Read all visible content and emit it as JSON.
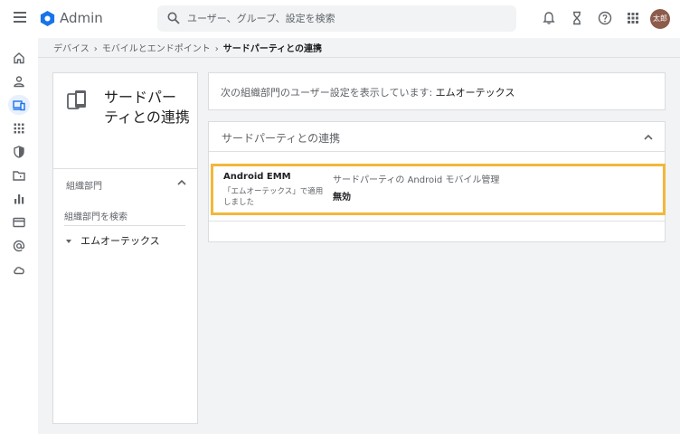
{
  "header": {
    "app_title": "Admin",
    "search_placeholder": "ユーザー、グループ、設定を検索",
    "avatar_text": "太郎",
    "brand_color": "#1a73e8",
    "avatar_color": "#8d5b4c"
  },
  "nav": {
    "items": [
      {
        "icon": "home-icon"
      },
      {
        "icon": "person-icon"
      },
      {
        "icon": "devices-icon",
        "active": true
      },
      {
        "icon": "apps-icon"
      },
      {
        "icon": "security-icon"
      },
      {
        "icon": "folder-icon"
      },
      {
        "icon": "reports-icon"
      },
      {
        "icon": "billing-icon"
      },
      {
        "icon": "account-icon"
      },
      {
        "icon": "cloud-icon"
      }
    ]
  },
  "breadcrumb": {
    "items": [
      "デバイス",
      "モバイルとエンドポイント"
    ],
    "current": "サードパーティとの連携"
  },
  "left_panel": {
    "title": "サードパーティとの連携",
    "ou_label": "組織部門",
    "ou_search_placeholder": "組織部門を検索",
    "tree_item": "エムオーテックス"
  },
  "info": {
    "label": "次の組織部門のユーザー設定を表示しています: ",
    "value": "エムオーテックス"
  },
  "settings": {
    "section_title": "サードパーティとの連携",
    "row": {
      "name": "Android EMM",
      "applied": "「エムオーテックス」で適用しました",
      "setting_label": "サードパーティの Android モバイル管理",
      "setting_value": "無効",
      "highlight_color": "#f3b73a"
    }
  }
}
